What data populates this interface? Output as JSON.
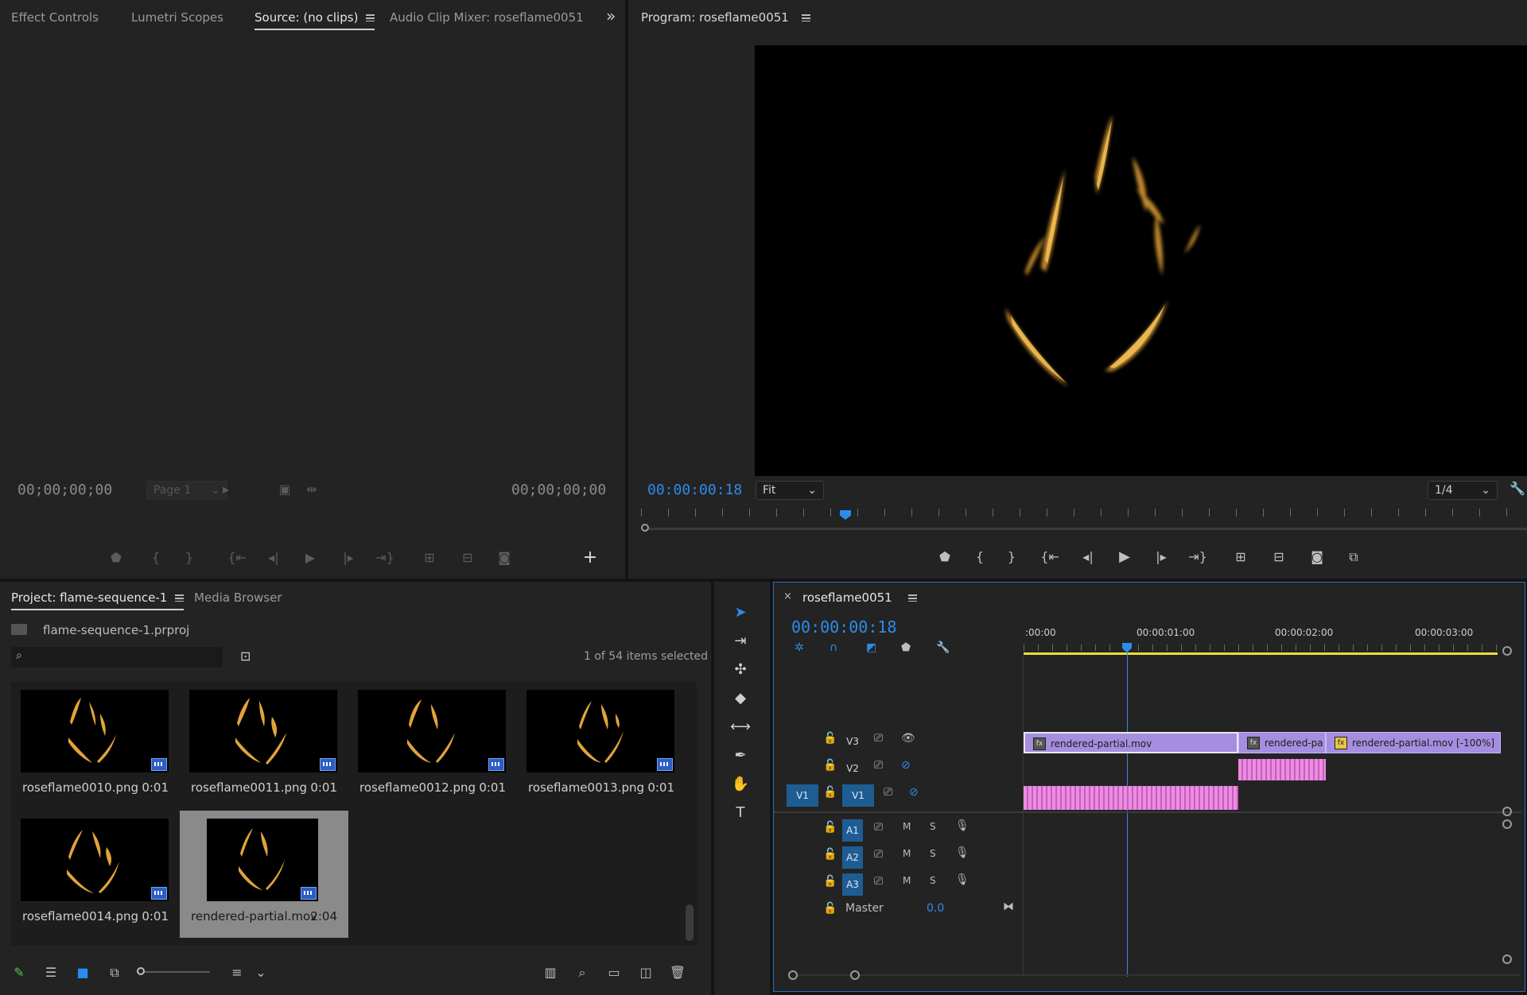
{
  "source_panel": {
    "tabs": [
      "Effect Controls",
      "Lumetri Scopes",
      "Source: (no clips)",
      "Audio Clip Mixer: roseflame0051"
    ],
    "overflow": "»",
    "timecode_left": "00;00;00;00",
    "timecode_right": "00;00;00;00",
    "page_select": "Page 1",
    "add": "+"
  },
  "program_panel": {
    "title": "Program: roseflame0051",
    "timecode": "00:00:00:18",
    "fit": "Fit",
    "resolution": "1/4"
  },
  "project_panel": {
    "tabs": [
      "Project: flame-sequence-1",
      "Media Browser"
    ],
    "project_file": "flame-sequence-1.prproj",
    "search_placeholder": "",
    "selection_info": "1 of 54 items selected",
    "items": [
      {
        "name": "roseflame0010.png",
        "duration": "0:01"
      },
      {
        "name": "roseflame0011.png",
        "duration": "0:01"
      },
      {
        "name": "roseflame0012.png",
        "duration": "0:01"
      },
      {
        "name": "roseflame0013.png",
        "duration": "0:01"
      },
      {
        "name": "roseflame0014.png",
        "duration": "0:01"
      },
      {
        "name": "rendered-partial.mov",
        "duration": "2:04"
      }
    ]
  },
  "timeline": {
    "sequence_name": "roseflame0051",
    "timecode": "00:00:00:18",
    "ruler": [
      ":00:00",
      "00:00:01:00",
      "00:00:02:00",
      "00:00:03:00"
    ],
    "video_tracks": [
      {
        "id": "V3",
        "source": ""
      },
      {
        "id": "V2",
        "source": ""
      },
      {
        "id": "V1",
        "source": "V1"
      }
    ],
    "audio_tracks": [
      {
        "id": "A1",
        "m": "M",
        "s": "S"
      },
      {
        "id": "A2",
        "m": "M",
        "s": "S"
      },
      {
        "id": "A3",
        "m": "M",
        "s": "S"
      }
    ],
    "master": {
      "label": "Master",
      "value": "0.0"
    },
    "clips": [
      {
        "label": "rendered-partial.mov",
        "fx": "fx"
      },
      {
        "label": "rendered-pa",
        "fx": "fx"
      },
      {
        "label": "rendered-partial.mov [-100%]",
        "fx": "fx"
      }
    ]
  },
  "colors": {
    "accent": "#2d8ceb",
    "clip_purple": "#a58de0",
    "clip_pink": "#ea8ee0",
    "flame": "#e0a43a"
  }
}
